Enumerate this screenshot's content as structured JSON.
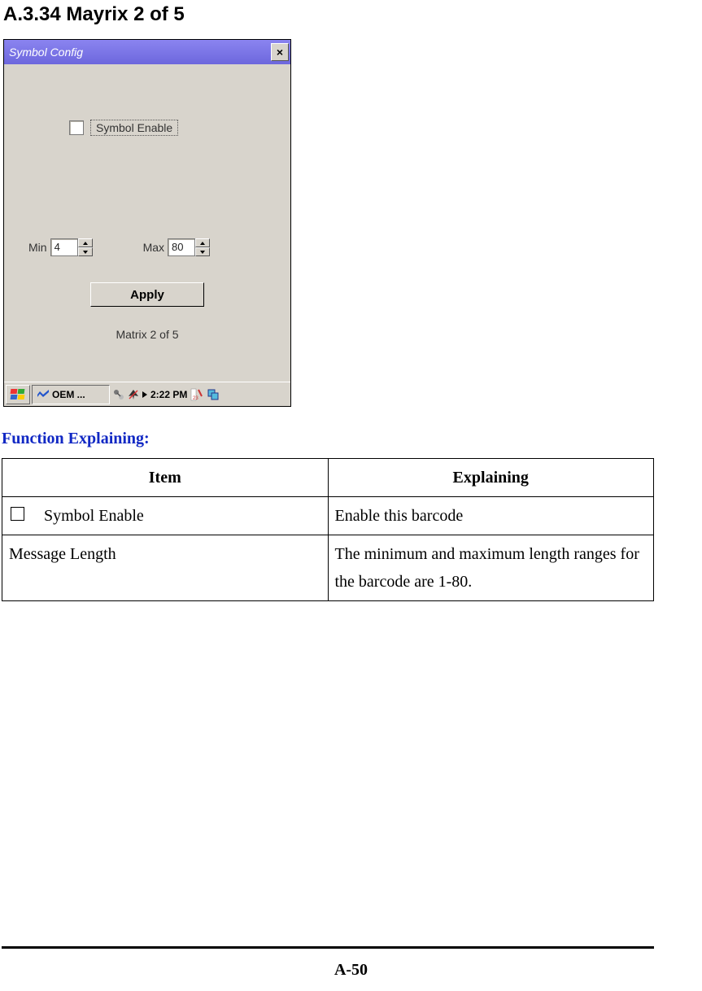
{
  "section": {
    "title": "A.3.34 Mayrix 2 of 5"
  },
  "window": {
    "title": "Symbol Config",
    "symbol_enable_label": "Symbol Enable",
    "min_label": "Min",
    "min_value": "4",
    "max_label": "Max",
    "max_value": "80",
    "apply_label": "Apply",
    "caption": "Matrix 2 of 5"
  },
  "taskbar": {
    "task_label": "OEM ...",
    "time": "2:22 PM"
  },
  "function_explaining": {
    "heading": "Function Explaining:",
    "headers": {
      "item": "Item",
      "explaining": "Explaining"
    },
    "rows": [
      {
        "item": "Symbol Enable",
        "explaining": "Enable this barcode"
      },
      {
        "item": "Message Length",
        "explaining": "The minimum and maximum length ranges for the barcode are 1-80."
      }
    ]
  },
  "footer": {
    "page": "A-50"
  }
}
